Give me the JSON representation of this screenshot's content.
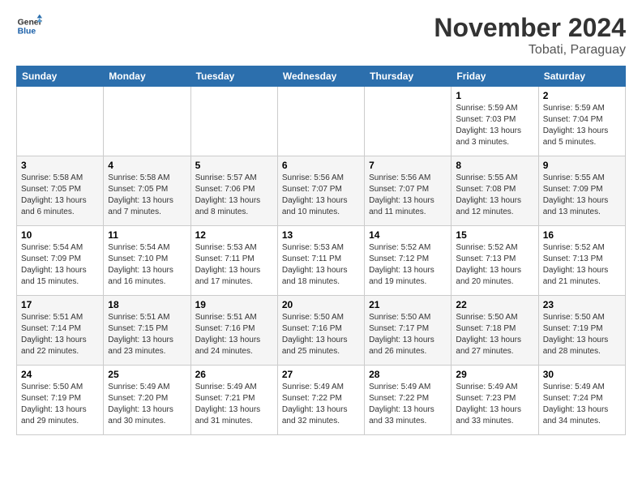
{
  "logo": {
    "line1": "General",
    "line2": "Blue"
  },
  "title": "November 2024",
  "subtitle": "Tobati, Paraguay",
  "days_header": [
    "Sunday",
    "Monday",
    "Tuesday",
    "Wednesday",
    "Thursday",
    "Friday",
    "Saturday"
  ],
  "weeks": [
    [
      {
        "day": "",
        "info": ""
      },
      {
        "day": "",
        "info": ""
      },
      {
        "day": "",
        "info": ""
      },
      {
        "day": "",
        "info": ""
      },
      {
        "day": "",
        "info": ""
      },
      {
        "day": "1",
        "info": "Sunrise: 5:59 AM\nSunset: 7:03 PM\nDaylight: 13 hours\nand 3 minutes."
      },
      {
        "day": "2",
        "info": "Sunrise: 5:59 AM\nSunset: 7:04 PM\nDaylight: 13 hours\nand 5 minutes."
      }
    ],
    [
      {
        "day": "3",
        "info": "Sunrise: 5:58 AM\nSunset: 7:05 PM\nDaylight: 13 hours\nand 6 minutes."
      },
      {
        "day": "4",
        "info": "Sunrise: 5:58 AM\nSunset: 7:05 PM\nDaylight: 13 hours\nand 7 minutes."
      },
      {
        "day": "5",
        "info": "Sunrise: 5:57 AM\nSunset: 7:06 PM\nDaylight: 13 hours\nand 8 minutes."
      },
      {
        "day": "6",
        "info": "Sunrise: 5:56 AM\nSunset: 7:07 PM\nDaylight: 13 hours\nand 10 minutes."
      },
      {
        "day": "7",
        "info": "Sunrise: 5:56 AM\nSunset: 7:07 PM\nDaylight: 13 hours\nand 11 minutes."
      },
      {
        "day": "8",
        "info": "Sunrise: 5:55 AM\nSunset: 7:08 PM\nDaylight: 13 hours\nand 12 minutes."
      },
      {
        "day": "9",
        "info": "Sunrise: 5:55 AM\nSunset: 7:09 PM\nDaylight: 13 hours\nand 13 minutes."
      }
    ],
    [
      {
        "day": "10",
        "info": "Sunrise: 5:54 AM\nSunset: 7:09 PM\nDaylight: 13 hours\nand 15 minutes."
      },
      {
        "day": "11",
        "info": "Sunrise: 5:54 AM\nSunset: 7:10 PM\nDaylight: 13 hours\nand 16 minutes."
      },
      {
        "day": "12",
        "info": "Sunrise: 5:53 AM\nSunset: 7:11 PM\nDaylight: 13 hours\nand 17 minutes."
      },
      {
        "day": "13",
        "info": "Sunrise: 5:53 AM\nSunset: 7:11 PM\nDaylight: 13 hours\nand 18 minutes."
      },
      {
        "day": "14",
        "info": "Sunrise: 5:52 AM\nSunset: 7:12 PM\nDaylight: 13 hours\nand 19 minutes."
      },
      {
        "day": "15",
        "info": "Sunrise: 5:52 AM\nSunset: 7:13 PM\nDaylight: 13 hours\nand 20 minutes."
      },
      {
        "day": "16",
        "info": "Sunrise: 5:52 AM\nSunset: 7:13 PM\nDaylight: 13 hours\nand 21 minutes."
      }
    ],
    [
      {
        "day": "17",
        "info": "Sunrise: 5:51 AM\nSunset: 7:14 PM\nDaylight: 13 hours\nand 22 minutes."
      },
      {
        "day": "18",
        "info": "Sunrise: 5:51 AM\nSunset: 7:15 PM\nDaylight: 13 hours\nand 23 minutes."
      },
      {
        "day": "19",
        "info": "Sunrise: 5:51 AM\nSunset: 7:16 PM\nDaylight: 13 hours\nand 24 minutes."
      },
      {
        "day": "20",
        "info": "Sunrise: 5:50 AM\nSunset: 7:16 PM\nDaylight: 13 hours\nand 25 minutes."
      },
      {
        "day": "21",
        "info": "Sunrise: 5:50 AM\nSunset: 7:17 PM\nDaylight: 13 hours\nand 26 minutes."
      },
      {
        "day": "22",
        "info": "Sunrise: 5:50 AM\nSunset: 7:18 PM\nDaylight: 13 hours\nand 27 minutes."
      },
      {
        "day": "23",
        "info": "Sunrise: 5:50 AM\nSunset: 7:19 PM\nDaylight: 13 hours\nand 28 minutes."
      }
    ],
    [
      {
        "day": "24",
        "info": "Sunrise: 5:50 AM\nSunset: 7:19 PM\nDaylight: 13 hours\nand 29 minutes."
      },
      {
        "day": "25",
        "info": "Sunrise: 5:49 AM\nSunset: 7:20 PM\nDaylight: 13 hours\nand 30 minutes."
      },
      {
        "day": "26",
        "info": "Sunrise: 5:49 AM\nSunset: 7:21 PM\nDaylight: 13 hours\nand 31 minutes."
      },
      {
        "day": "27",
        "info": "Sunrise: 5:49 AM\nSunset: 7:22 PM\nDaylight: 13 hours\nand 32 minutes."
      },
      {
        "day": "28",
        "info": "Sunrise: 5:49 AM\nSunset: 7:22 PM\nDaylight: 13 hours\nand 33 minutes."
      },
      {
        "day": "29",
        "info": "Sunrise: 5:49 AM\nSunset: 7:23 PM\nDaylight: 13 hours\nand 33 minutes."
      },
      {
        "day": "30",
        "info": "Sunrise: 5:49 AM\nSunset: 7:24 PM\nDaylight: 13 hours\nand 34 minutes."
      }
    ]
  ]
}
